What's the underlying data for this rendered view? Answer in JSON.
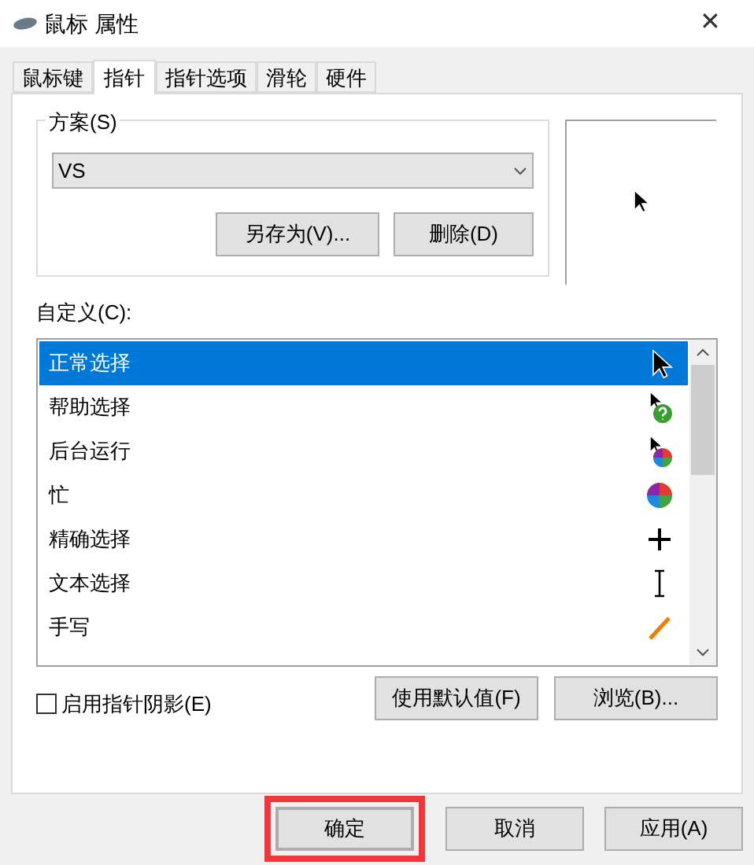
{
  "window": {
    "title": "鼠标 属性",
    "close": "✕"
  },
  "tabs": [
    {
      "label": "鼠标键",
      "selected": false
    },
    {
      "label": "指针",
      "selected": true
    },
    {
      "label": "指针选项",
      "selected": false
    },
    {
      "label": "滑轮",
      "selected": false
    },
    {
      "label": "硬件",
      "selected": false
    }
  ],
  "scheme": {
    "label": "方案(S)",
    "value": "VS",
    "buttons": [
      "另存为(V)...",
      "删除(D)"
    ]
  },
  "customize": {
    "label": "自定义(C):",
    "items": [
      {
        "name": "正常选择",
        "kind": "arrow",
        "selected": true
      },
      {
        "name": "帮助选择",
        "kind": "help",
        "selected": false
      },
      {
        "name": "后台运行",
        "kind": "working",
        "selected": false
      },
      {
        "name": "忙",
        "kind": "busy",
        "selected": false
      },
      {
        "name": "精确选择",
        "kind": "cross",
        "selected": false
      },
      {
        "name": "文本选择",
        "kind": "beam",
        "selected": false
      },
      {
        "name": "手写",
        "kind": "pen",
        "selected": false
      }
    ]
  },
  "shadow": {
    "label": "启用指针阴影(E)",
    "checked": false
  },
  "list_buttons": [
    "使用默认值(F)",
    "浏览(B)..."
  ],
  "buttons": [
    {
      "label": "确定",
      "default": true,
      "highlighted": true
    },
    {
      "label": "取消",
      "default": false,
      "highlighted": false
    },
    {
      "label": "应用(A)",
      "default": false,
      "highlighted": false
    }
  ]
}
